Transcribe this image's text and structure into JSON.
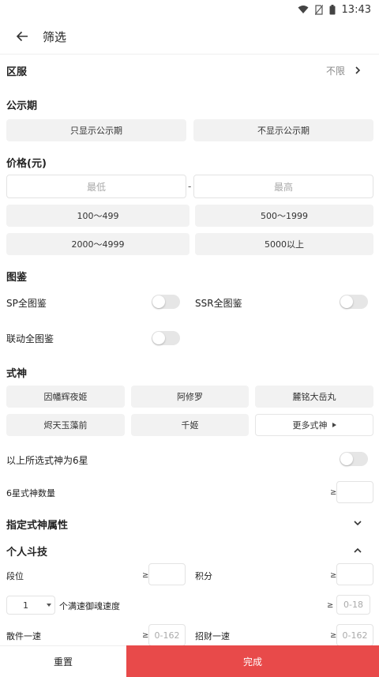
{
  "status_bar": {
    "time": "13:43",
    "icons": [
      "wifi-icon",
      "no-sim-icon",
      "battery-icon"
    ]
  },
  "app_bar": {
    "back_icon": "arrow-left-icon",
    "title": "筛选"
  },
  "server": {
    "title": "区服",
    "value": "不限"
  },
  "announcement": {
    "title": "公示期",
    "options": [
      "只显示公示期",
      "不显示公示期"
    ]
  },
  "price": {
    "title": "价格(元)",
    "min_placeholder": "最低",
    "separator": "-",
    "max_placeholder": "最高",
    "ranges": [
      "100～499",
      "500～1999",
      "2000～4999",
      "5000以上"
    ]
  },
  "catalog": {
    "title": "图鉴",
    "sp": "SP全图鉴",
    "ssr": "SSR全图鉴",
    "collab": "联动全图鉴"
  },
  "shikigami": {
    "title": "式神",
    "items": [
      "因幡辉夜姬",
      "阿修罗",
      "麓铭大岳丸",
      "烬天玉藻前",
      "千姬"
    ],
    "more": "更多式神",
    "six_star_label": "以上所选式神为6星",
    "six_star_count_label": "6星式神数量",
    "ge": "≥"
  },
  "attributes": {
    "title": "指定式神属性"
  },
  "pvp": {
    "title": "个人斗技",
    "rank_label": "段位",
    "points_label": "积分",
    "speed_select_value": "1",
    "speed_label": "个满速御魂速度",
    "speed_placeholder": "0-18",
    "scatter_label": "散件一速",
    "scatter_placeholder": "0-162",
    "fortune_label": "招财一速",
    "fortune_placeholder": "0-162",
    "ge": "≥"
  },
  "footer": {
    "reset": "重置",
    "done": "完成"
  },
  "colors": {
    "accent": "#e84a4a",
    "chip_bg": "#f2f2f2",
    "toggle_off": "#e6e6e6"
  }
}
